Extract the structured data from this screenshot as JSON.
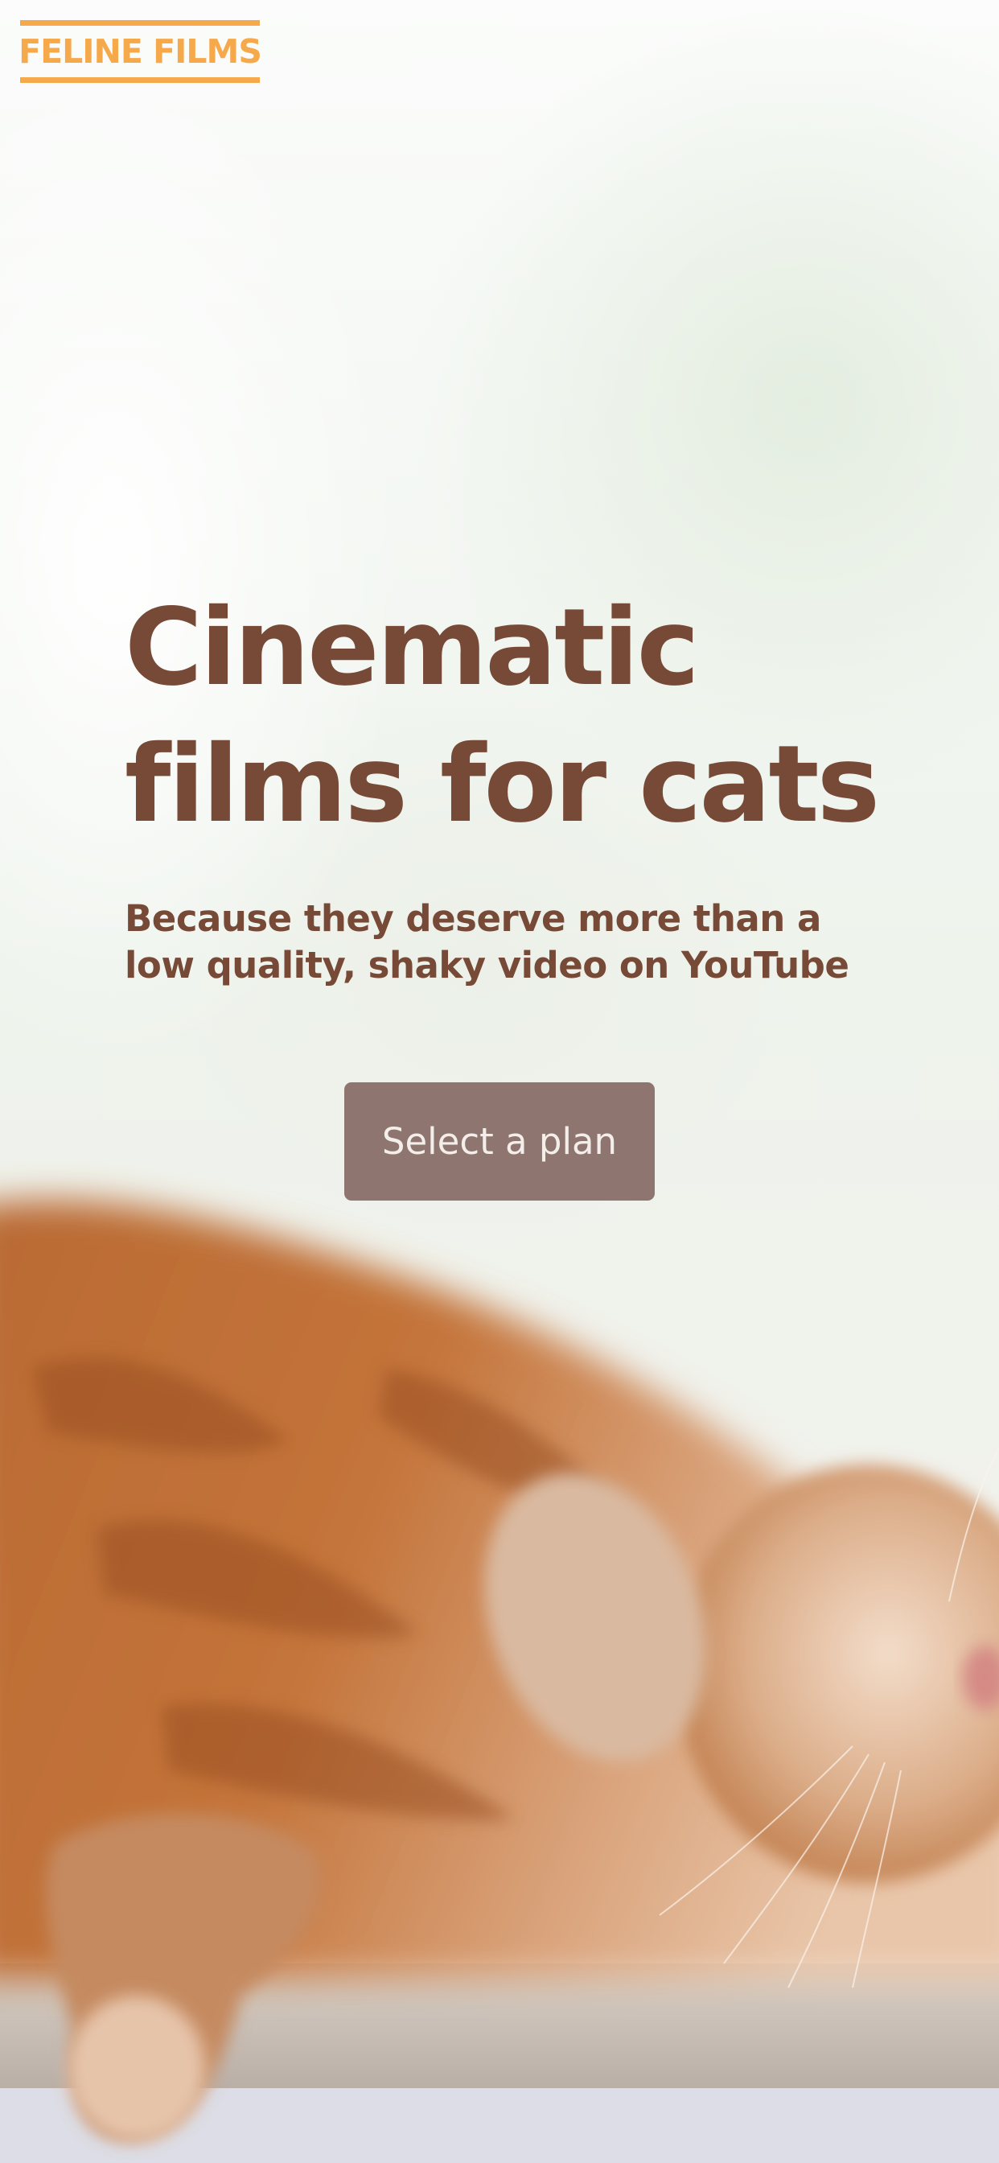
{
  "brand": {
    "logo_text": "FELINE FILMS",
    "logo_color": "#f6a94b"
  },
  "hero": {
    "title": "Cinematic films for cats",
    "subtitle": "Because they deserve more than a low quality, shaky video on YouTube",
    "cta_label": "Select a plan",
    "text_color": "#774937",
    "cta_color": "#8e7570"
  },
  "background": {
    "image_subject": "sleeping orange tabby cat lying on a windowsill",
    "icon": "cat-photo"
  }
}
